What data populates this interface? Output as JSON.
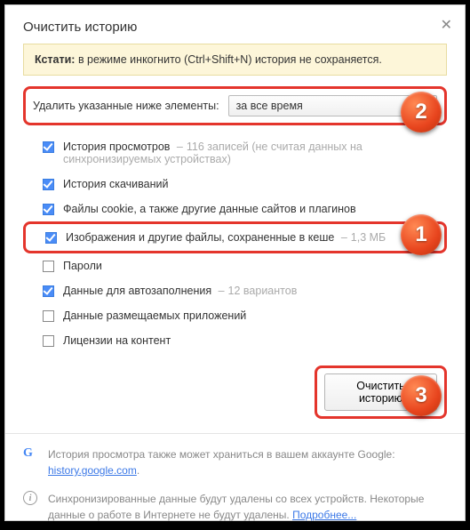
{
  "title": "Очистить историю",
  "tip": {
    "prefix": "Кстати: ",
    "text": "в режиме инкогнито (Ctrl+Shift+N) история не сохраняется."
  },
  "select": {
    "label": "Удалить указанные ниже элементы:",
    "value": "за все время"
  },
  "items": [
    {
      "checked": true,
      "label": "История просмотров",
      "sub": "116 записей (не считая данных на синхронизируемых устройствах)"
    },
    {
      "checked": true,
      "label": "История скачиваний"
    },
    {
      "checked": true,
      "label": "Файлы cookie, а также другие данные сайтов и плагинов"
    },
    {
      "checked": true,
      "label": "Изображения и другие файлы, сохраненные в кеше",
      "sub_inline": "1,3 МБ"
    },
    {
      "checked": false,
      "label": "Пароли"
    },
    {
      "checked": true,
      "label": "Данные для автозаполнения",
      "sub_inline": "12 вариантов"
    },
    {
      "checked": false,
      "label": "Данные размещаемых приложений"
    },
    {
      "checked": false,
      "label": "Лицензии на контент"
    }
  ],
  "button": "Очистить историю",
  "footer": {
    "google": {
      "text": "История просмотра также может храниться в вашем аккаунте Google: ",
      "link": "history.google.com"
    },
    "info": {
      "text": "Синхронизированные данные будут удалены со всех устройств. Некоторые данные о работе в Интернете не будут удалены. ",
      "link": "Подробнее..."
    }
  },
  "badges": {
    "1": "1",
    "2": "2",
    "3": "3"
  }
}
